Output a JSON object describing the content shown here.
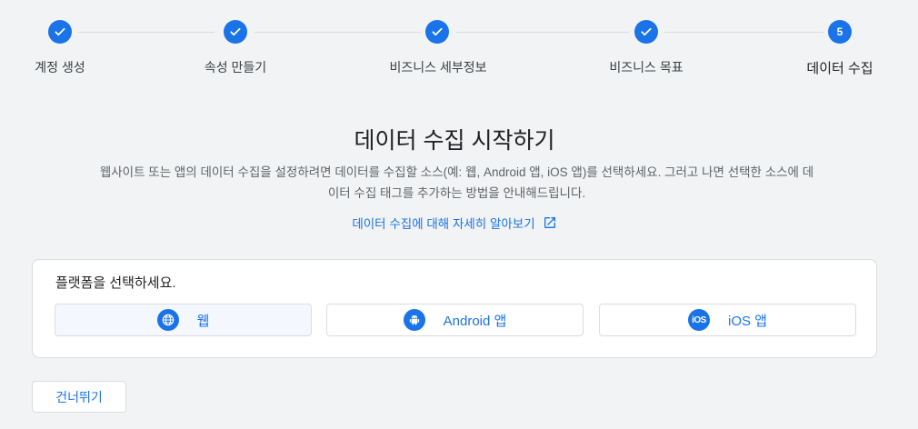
{
  "stepper": {
    "steps": [
      {
        "label": "계정 생성",
        "state": "done"
      },
      {
        "label": "속성 만들기",
        "state": "done"
      },
      {
        "label": "비즈니스 세부정보",
        "state": "done"
      },
      {
        "label": "비즈니스 목표",
        "state": "done"
      },
      {
        "label": "데이터 수집",
        "state": "active",
        "number": "5"
      }
    ]
  },
  "main": {
    "title": "데이터 수집 시작하기",
    "description": "웹사이트 또는 앱의 데이터 수집을 설정하려면 데이터를 수집할 소스(예: 웹, Android 앱, iOS 앱)를 선택하세요. 그러고 나면 선택한 소스에 데이터 수집 태그를 추가하는 방법을 안내해드립니다.",
    "learn_more_link": "데이터 수집에 대해 자세히 알아보기"
  },
  "platform": {
    "title": "플랫폼을 선택하세요.",
    "options": [
      {
        "label": "웹",
        "icon": "globe-icon",
        "selected": true
      },
      {
        "label": "Android 앱",
        "icon": "android-icon",
        "selected": false
      },
      {
        "label": "iOS 앱",
        "icon": "ios-icon",
        "icon_text": "iOS",
        "selected": false
      }
    ]
  },
  "footer": {
    "skip_label": "건너뛰기"
  },
  "colors": {
    "accent": "#1a73e8",
    "background": "#f1f3f4",
    "border": "#dadce0"
  }
}
